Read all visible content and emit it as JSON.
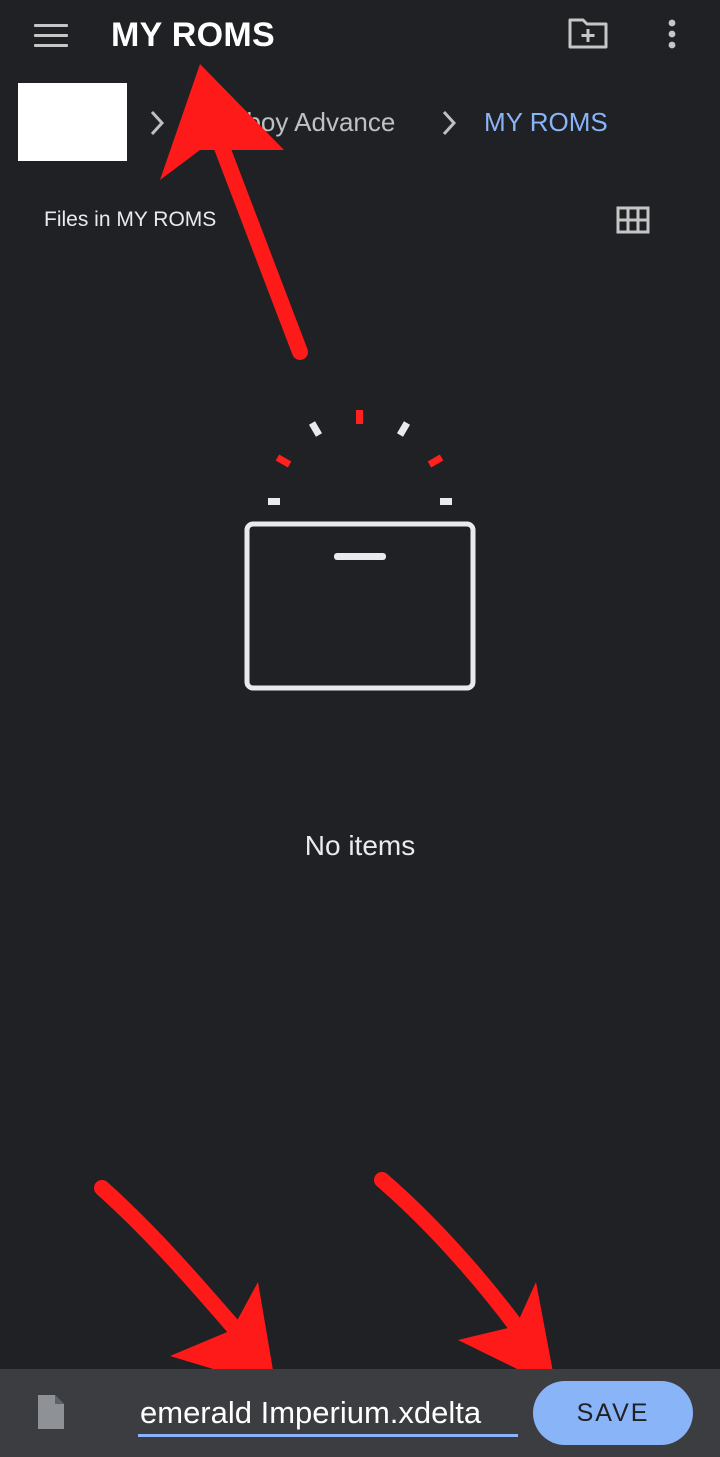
{
  "app_bar": {
    "title": "MY ROMS",
    "menu_icon": "hamburger-menu-icon",
    "new_folder_icon": "create-new-folder-icon",
    "more_icon": "more-vert-icon"
  },
  "breadcrumb": {
    "crumbs": [
      "eboy Advance",
      "MY ROMS"
    ],
    "chevron_icon": "chevron-right-icon"
  },
  "file_list": {
    "heading": "Files in MY ROMS",
    "view_toggle_icon": "grid-view-icon",
    "empty_message": "No items"
  },
  "save_bar": {
    "file_icon": "document-icon",
    "filename_value": "emerald Imperium.xdelta",
    "save_label": "SAVE"
  },
  "colors": {
    "background": "#202124",
    "accent": "#8ab4f8",
    "bottom_bar": "#3c3d40",
    "annotation_red": "#ff1a1a"
  }
}
